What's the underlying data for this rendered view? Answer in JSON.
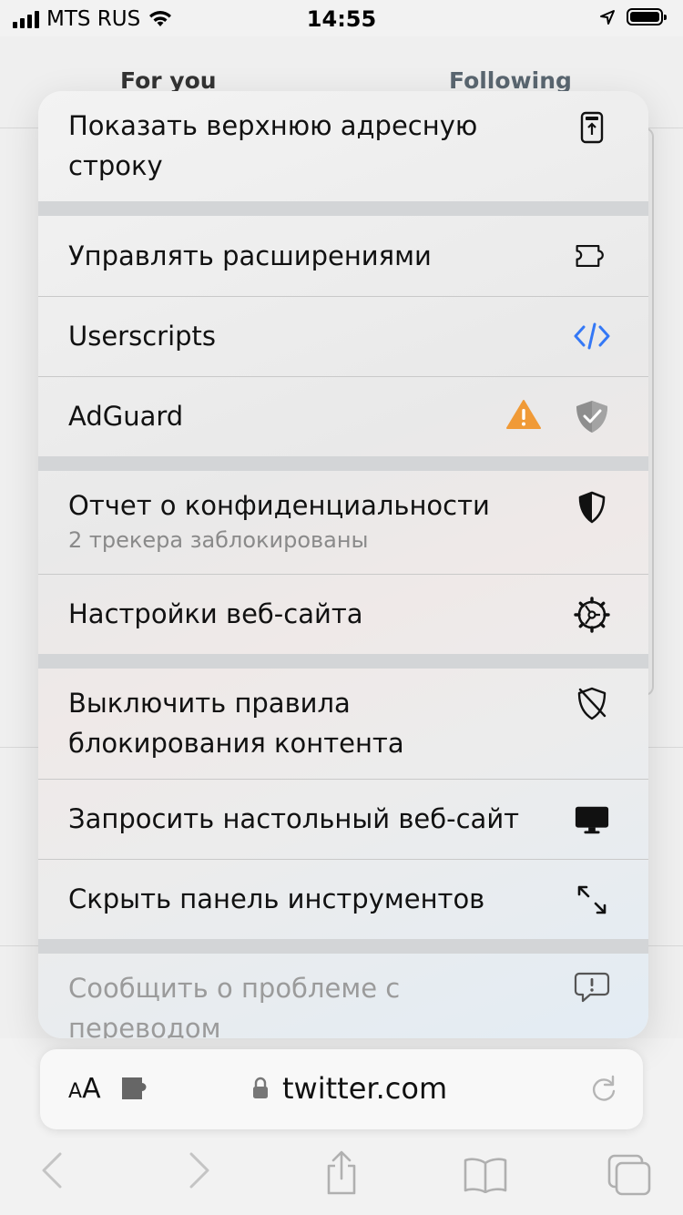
{
  "status_bar": {
    "carrier": "MTS RUS",
    "time": "14:55"
  },
  "background_page": {
    "tab_left": "For you",
    "tab_right": "Following"
  },
  "menu": {
    "items": [
      {
        "label": "Показать верхнюю адресную строку",
        "icon": "show-top-address-bar-icon"
      },
      {
        "label": "Управлять расширениями",
        "icon": "extensions-icon"
      },
      {
        "label": "Userscripts",
        "icon": "code-icon"
      },
      {
        "label": "AdGuard",
        "icon": "adguard-shield-icon",
        "badge_icon": "warning-icon"
      },
      {
        "label": "Отчет о конфиденциальности",
        "sublabel": "2 трекера заблокированы",
        "icon": "privacy-shield-icon"
      },
      {
        "label": "Настройки веб-сайта",
        "icon": "website-settings-gear-icon"
      },
      {
        "label": "Выключить правила блокирования контента",
        "icon": "content-blocker-off-icon"
      },
      {
        "label": "Запросить настольный веб-сайт",
        "icon": "desktop-icon"
      },
      {
        "label": "Скрыть панель инструментов",
        "icon": "hide-toolbar-arrows-icon"
      },
      {
        "label": "Сообщить о проблеме с переводом",
        "icon": "report-bubble-icon"
      }
    ],
    "colors": {
      "code_icon": "#3478f6",
      "warning": "#f09a37",
      "adguard_shield": "#8e8e8e"
    }
  },
  "address_bar": {
    "aa_label_small": "A",
    "aa_label_large": "A",
    "url": "twitter.com"
  },
  "toolbar": {
    "icons": [
      "back-icon",
      "forward-icon",
      "share-icon",
      "bookmarks-icon",
      "tabs-icon"
    ]
  }
}
